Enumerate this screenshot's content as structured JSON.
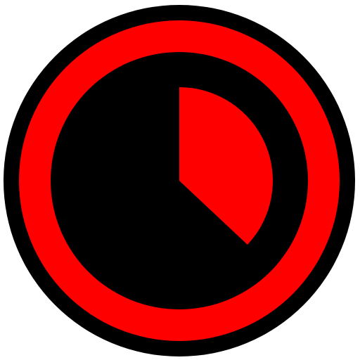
{
  "app_icon": {
    "name": "timer-app-icon",
    "progress_fraction": 0.37,
    "colors": {
      "background": "#ffffff",
      "outer_ring": "#000000",
      "red_ring": "#ff0000",
      "inner_disc": "#000000",
      "progress_wedge": "#ff0000"
    }
  }
}
